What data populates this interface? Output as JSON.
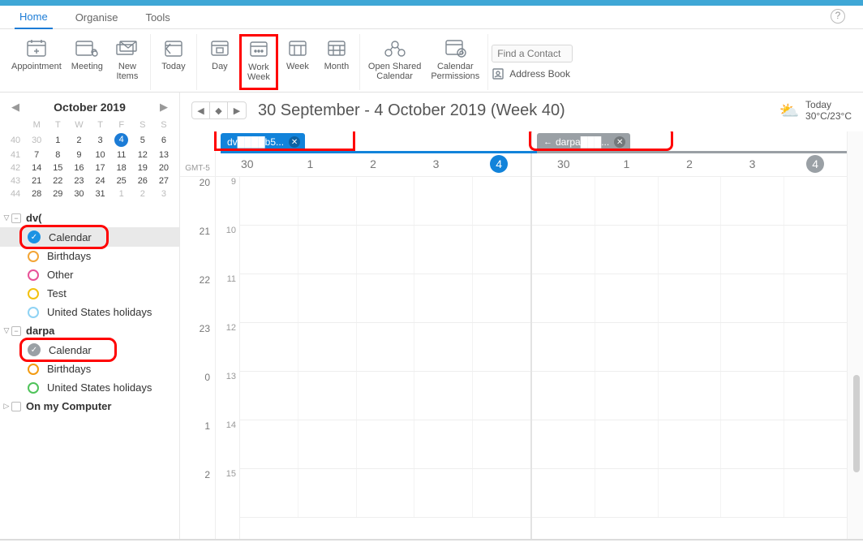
{
  "tabs": {
    "home": "Home",
    "organise": "Organise",
    "tools": "Tools"
  },
  "ribbon": {
    "appointment": "Appointment",
    "meeting": "Meeting",
    "new_items": "New\nItems",
    "today": "Today",
    "day": "Day",
    "work_week": "Work\nWeek",
    "week": "Week",
    "month": "Month",
    "open_shared": "Open Shared\nCalendar",
    "cal_perms": "Calendar\nPermissions",
    "find_contact_placeholder": "Find a Contact",
    "address_book": "Address Book"
  },
  "minical": {
    "title": "October 2019",
    "dow": [
      "M",
      "T",
      "W",
      "T",
      "F",
      "S",
      "S"
    ],
    "weeks": [
      {
        "wk": "40",
        "days": [
          "30",
          "1",
          "2",
          "3",
          "4",
          "5",
          "6"
        ],
        "gray": [
          0
        ],
        "today_idx": 4
      },
      {
        "wk": "41",
        "days": [
          "7",
          "8",
          "9",
          "10",
          "11",
          "12",
          "13"
        ],
        "gray": [],
        "today_idx": -1
      },
      {
        "wk": "42",
        "days": [
          "14",
          "15",
          "16",
          "17",
          "18",
          "19",
          "20"
        ],
        "gray": [],
        "today_idx": -1
      },
      {
        "wk": "43",
        "days": [
          "21",
          "22",
          "23",
          "24",
          "25",
          "26",
          "27"
        ],
        "gray": [],
        "today_idx": -1
      },
      {
        "wk": "44",
        "days": [
          "28",
          "29",
          "30",
          "31",
          "1",
          "2",
          "3"
        ],
        "gray": [
          4,
          5,
          6
        ],
        "today_idx": -1
      }
    ]
  },
  "accounts": [
    {
      "name": "dv(",
      "calendars": [
        {
          "label": "Calendar",
          "color": "#1c93e3",
          "filled": true,
          "selected": true,
          "highlight": true
        },
        {
          "label": "Birthdays",
          "color": "#f3a536",
          "filled": false
        },
        {
          "label": "Other",
          "color": "#e85298",
          "filled": false
        },
        {
          "label": "Test",
          "color": "#f3c10e",
          "filled": false
        },
        {
          "label": "United States holidays",
          "color": "#8fd3f4",
          "filled": false
        }
      ]
    },
    {
      "name": "darpa",
      "calendars": [
        {
          "label": "Calendar",
          "color": "#9aa0a5",
          "filled": true,
          "selected": false,
          "highlight": true
        },
        {
          "label": "Birthdays",
          "color": "#f39b12",
          "filled": false
        },
        {
          "label": "United States holidays",
          "color": "#4fc35a",
          "filled": false
        }
      ]
    }
  ],
  "on_my_computer": "On my Computer",
  "range_title": "30 September - 4 October 2019 (Week 40)",
  "weather": {
    "label": "Today",
    "temp": "30°C/23°C"
  },
  "panel_tabs": {
    "left": "dv████b5...",
    "right": "darpa███..."
  },
  "tz": "GMT-5",
  "day_numbers": [
    "30",
    "1",
    "2",
    "3",
    "4"
  ],
  "gutter_hours": [
    "20",
    "21",
    "22",
    "23",
    "0",
    "1",
    "2"
  ],
  "inner_hours": [
    "9",
    "10",
    "11",
    "12",
    "13",
    "14",
    "15"
  ]
}
